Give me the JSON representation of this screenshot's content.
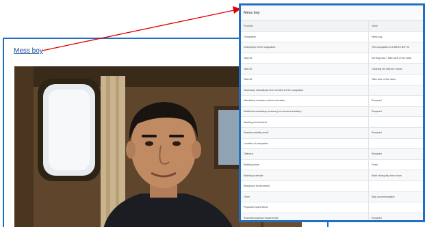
{
  "main": {
    "link_text": "Mess boy"
  },
  "panel": {
    "title": "Mess boy",
    "columns": [
      "Property",
      "Value"
    ],
    "rows": [
      [
        "Occupation",
        "Mess boy"
      ],
      [
        "Description of the occupation",
        "The occupation of a MESS BOY is"
      ],
      [
        "Task #1",
        "Serving food / Take care of the mess"
      ],
      [
        "Task #2",
        "Cleaning the officers' rooms"
      ],
      [
        "Task #3",
        "Take care of the mess"
      ],
      [
        "Necessary educational level needed for the occupation",
        ""
      ],
      [
        "Mandatory minimum school education",
        "Required"
      ],
      [
        "Additional mandatory courses (non-formal education)",
        "Required"
      ],
      [
        "Working environment",
        ""
      ],
      [
        "Seaside mobility on/off",
        "Required"
      ],
      [
        "Location of occupation",
        ""
      ],
      [
        "Offshore",
        "Required"
      ],
      [
        "Working hours",
        "Fixed"
      ],
      [
        "Working schedule",
        "Work during day time hours"
      ],
      [
        "Workplace environment",
        ""
      ],
      [
        "Other",
        "Ship accommodation"
      ],
      [
        "Physical requirements",
        ""
      ],
      [
        "Essential physical requirements",
        "Required"
      ]
    ]
  },
  "colors": {
    "accent": "#1f6fc4",
    "arrow": "#e00000",
    "link": "#1a4fa3"
  }
}
